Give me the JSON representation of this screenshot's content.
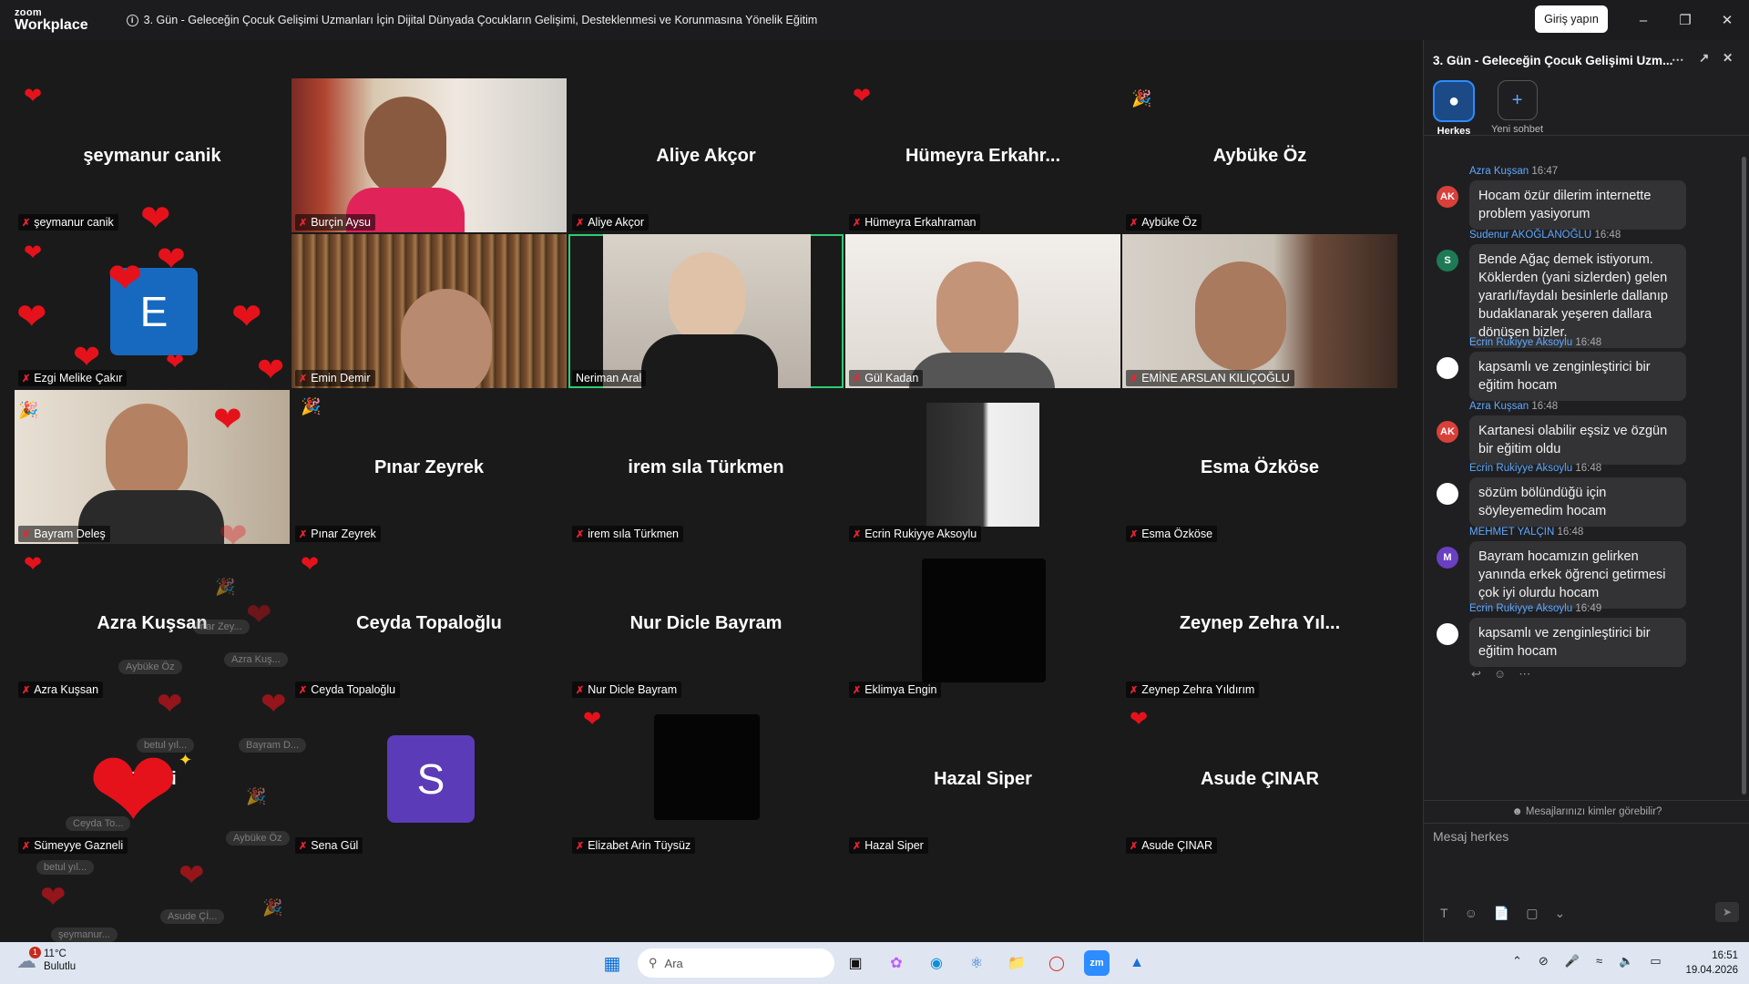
{
  "app": {
    "logo_small": "zoom",
    "logo_big": "Workplace",
    "meeting_title": "3. Gün - Geleceğin Çocuk Gelişimi Uzmanları İçin Dijital Dünyada Çocukların Gelişimi, Desteklenmesi ve Korunmasına Yönelik Eğitim",
    "signin": "Giriş yapın"
  },
  "tiles": [
    {
      "big": "şeymanur canik",
      "tag": "şeymanur canik"
    },
    {
      "big": "",
      "tag": "Burçin Aysu"
    },
    {
      "big": "Aliye Akçor",
      "tag": "Aliye Akçor"
    },
    {
      "big": "Hümeyra  Erkahr...",
      "tag": "Hümeyra Erkahraman"
    },
    {
      "big": "Aybüke Öz",
      "tag": "Aybüke Öz"
    },
    {
      "big": "",
      "tag": "Ezgi Melike Çakır",
      "avatar": "E"
    },
    {
      "big": "",
      "tag": "Emin Demir"
    },
    {
      "big": "",
      "tag": "Neriman Aral"
    },
    {
      "big": "",
      "tag": "Gül Kadan"
    },
    {
      "big": "",
      "tag": "EMİNE ARSLAN KILIÇOĞLU"
    },
    {
      "big": "",
      "tag": "Bayram Deleş"
    },
    {
      "big": "Pınar Zeyrek",
      "tag": "Pınar Zeyrek"
    },
    {
      "big": "irem sıla Türkmen",
      "tag": "irem sıla Türkmen"
    },
    {
      "big": "",
      "tag": "Ecrin Rukiyye Aksoylu"
    },
    {
      "big": "Esma Özköse",
      "tag": "Esma Özköse"
    },
    {
      "big": "Azra Kuşsan",
      "tag": "Azra Kuşsan"
    },
    {
      "big": "Ceyda Topaloğlu",
      "tag": "Ceyda Topaloğlu"
    },
    {
      "big": "Nur Dicle Bayram",
      "tag": "Nur Dicle Bayram"
    },
    {
      "big": "",
      "tag": "Eklimya Engin"
    },
    {
      "big": "Zeynep  Zehra  Yıl...",
      "tag": "Zeynep Zehra Yıldırım"
    },
    {
      "big": "S          neli",
      "tag": "Sümeyye Gazneli"
    },
    {
      "big": "",
      "tag": "Sena Gül",
      "avatar": "S"
    },
    {
      "big": "",
      "tag": "Elizabet Arin Tüysüz"
    },
    {
      "big": "Hazal Siper",
      "tag": "Hazal Siper"
    },
    {
      "big": "Asude ÇINAR",
      "tag": "Asude ÇINAR"
    }
  ],
  "ghost_chips": [
    "Aybüke Öz",
    "Azra Kuş...",
    "betul yıl...",
    "Bayram D...",
    "Ceyda To...",
    "Aybüke Öz",
    "betul yıl...",
    "Asude Çİ...",
    "şeymanur...",
    "nar Zey..."
  ],
  "chat": {
    "title": "3. Gün - Geleceğin Çocuk Gelişimi Uzm...",
    "tab_everyone": "Herkes",
    "tab_new": "Yeni sohbet",
    "messages": [
      {
        "sender": "Azra Kuşsan",
        "time": "16:47",
        "initials": "AK",
        "color": "#d9403a",
        "text": "Hocam özür dilerim internette problem yasiyorum"
      },
      {
        "sender": "Sudenur AKOĞLANOĞLU",
        "time": "16:48",
        "initials": "S",
        "color": "#1e7a55",
        "text": "Bende Ağaç demek istiyorum. Köklerden (yani sizlerden) gelen yararlı/faydalı besinlerle dallanıp budaklanarak yeşeren dallara dönüşen bizler."
      },
      {
        "sender": "Ecrin Rukiyye Aksoylu",
        "time": "16:48",
        "initials": "",
        "color": "#888",
        "text": "kapsamlı ve zenginleştirici  bir eğitim hocam"
      },
      {
        "sender": "Azra Kuşsan",
        "time": "16:48",
        "initials": "AK",
        "color": "#d9403a",
        "text": "Kartanesi olabilir eşsiz ve özgün bir eğitim oldu"
      },
      {
        "sender": "Ecrin Rukiyye Aksoylu",
        "time": "16:48",
        "initials": "",
        "color": "#888",
        "text": "sözüm bölündüğü için söyleyemedim hocam"
      },
      {
        "sender": "MEHMET YALÇIN",
        "time": "16:48",
        "initials": "M",
        "color": "#6a3fc2",
        "text": "Bayram hocamızın gelirken yanında erkek öğrenci getirmesi çok iyi olurdu hocam"
      },
      {
        "sender": "Ecrin Rukiyye Aksoylu",
        "time": "16:49",
        "initials": "",
        "color": "#888",
        "text": "kapsamlı ve zenginleştirici  bir eğitim hocam"
      }
    ],
    "who_sees": "Mesajlarınızı kimler görebilir?",
    "placeholder": "Mesaj herkes"
  },
  "taskbar": {
    "temp": "11°C",
    "weather": "Bulutlu",
    "badge": "1",
    "search": "Ara",
    "time": "16:51",
    "date": "19.04.2026"
  }
}
